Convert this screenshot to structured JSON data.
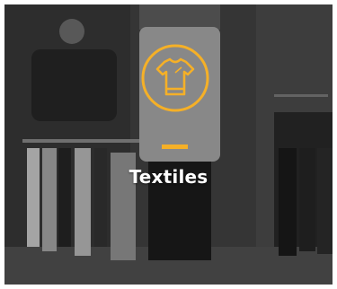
{
  "category": {
    "title": "Textiles",
    "icon": "tshirt-icon",
    "accent_color": "#f5b027"
  }
}
